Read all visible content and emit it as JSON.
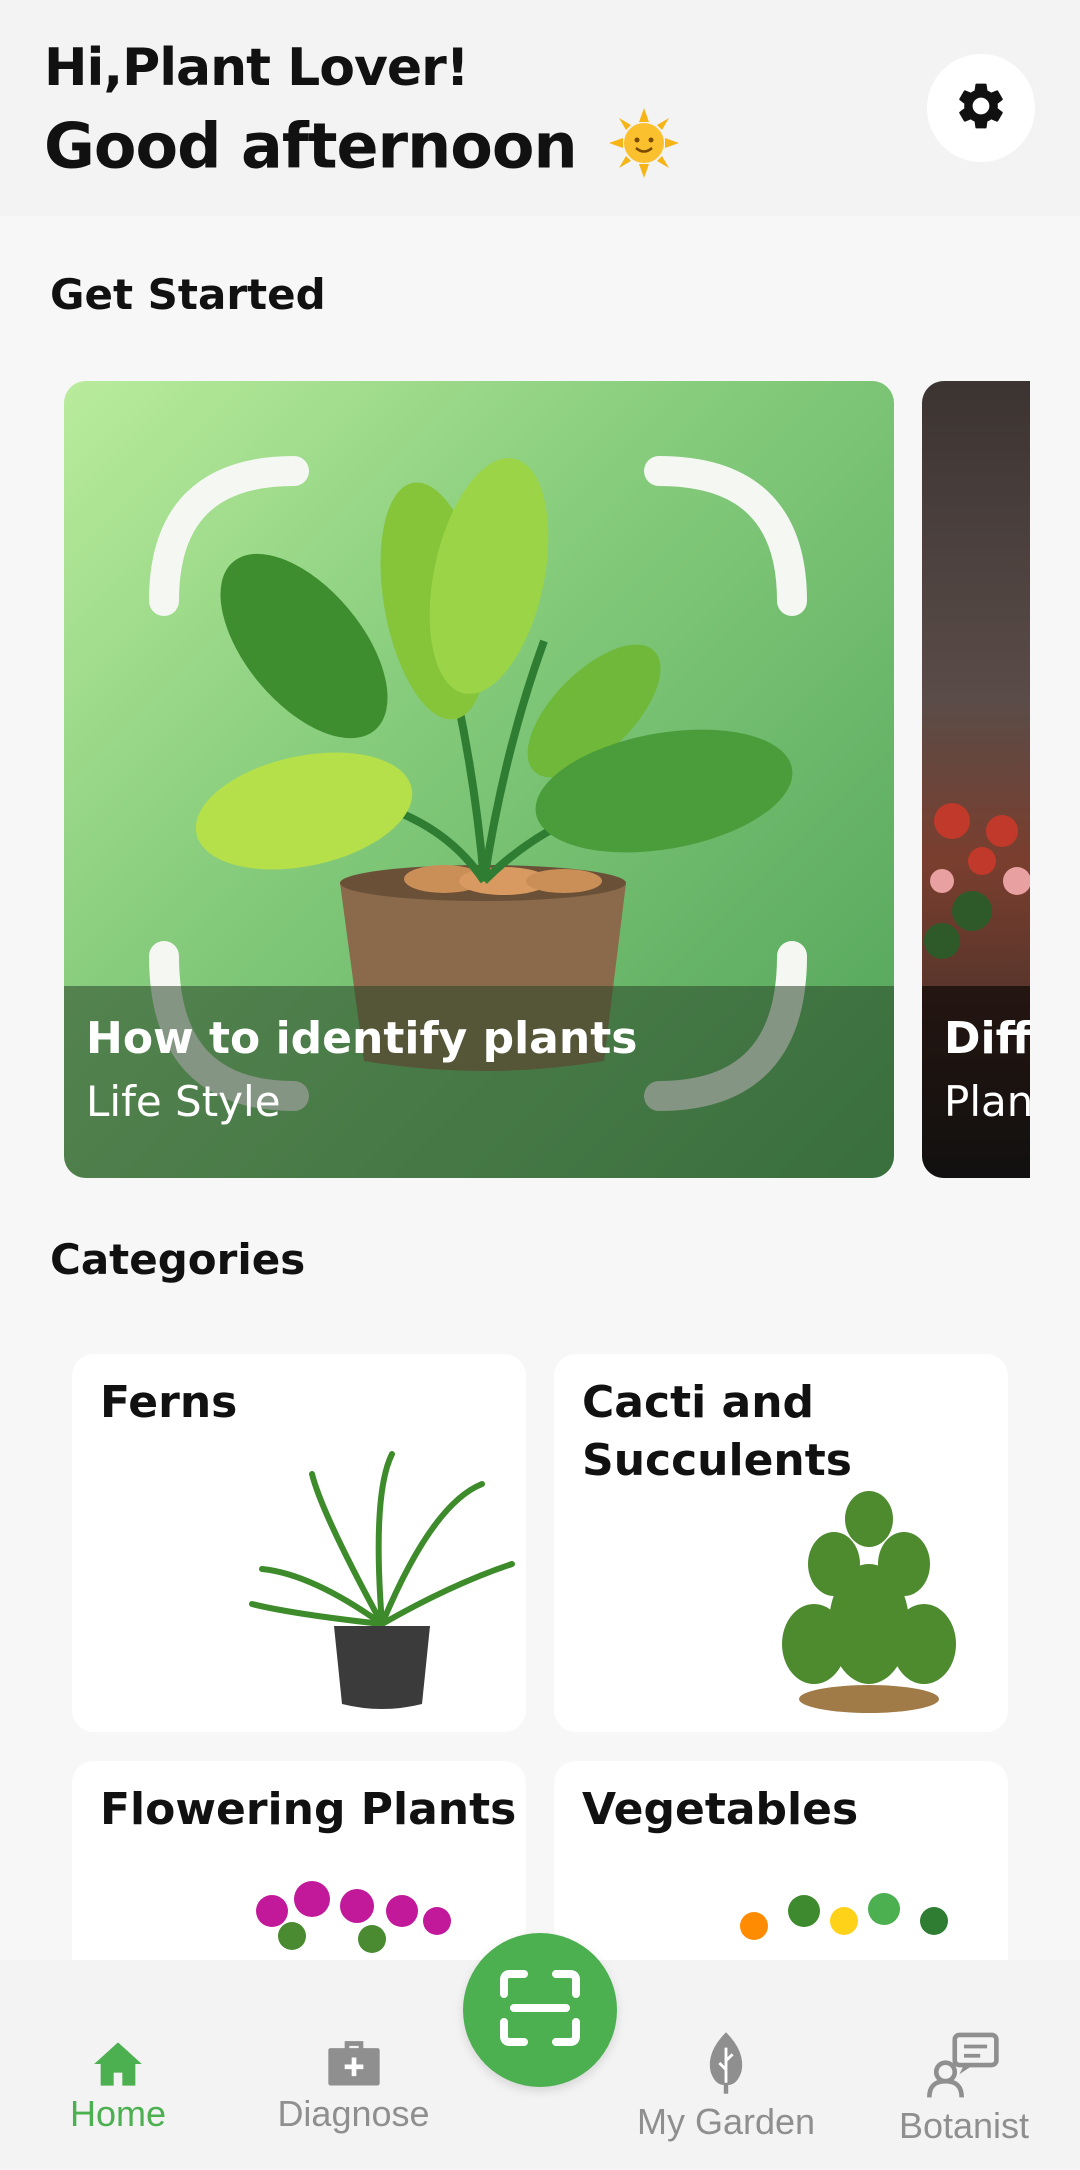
{
  "header": {
    "greeting": "Hi,Plant Lover!",
    "salutation": "Good afternoon",
    "settings_icon": "gear-icon"
  },
  "get_started": {
    "title": "Get Started",
    "cards": [
      {
        "title": "How to identify plants",
        "subtitle": "Life Style"
      },
      {
        "title": "Diffe",
        "subtitle": "Plan"
      }
    ]
  },
  "categories": {
    "title": "Categories",
    "items": [
      {
        "label": "Ferns"
      },
      {
        "label": "Cacti and Succulents"
      },
      {
        "label": "Flowering Plants"
      },
      {
        "label": "Vegetables"
      }
    ]
  },
  "nav": {
    "accent_color": "#4caf50",
    "inactive_color": "#8f8f8f",
    "items": [
      {
        "label": "Home",
        "icon": "home-icon",
        "active": true
      },
      {
        "label": "Diagnose",
        "icon": "medical-kit-icon",
        "active": false
      },
      {
        "label": "My Garden",
        "icon": "leaf-icon",
        "active": false
      },
      {
        "label": "Botanist",
        "icon": "botanist-chat-icon",
        "active": false
      }
    ],
    "scan_icon": "scan-icon"
  }
}
